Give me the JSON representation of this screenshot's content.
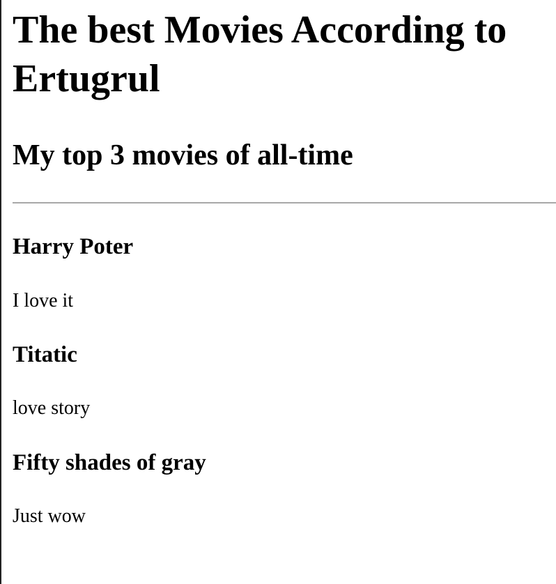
{
  "page": {
    "title": "The best Movies According to Ertugrul",
    "subtitle": "My top 3 movies of all-time"
  },
  "movies": [
    {
      "title": "Harry Poter",
      "description": "I love it"
    },
    {
      "title": "Titatic",
      "description": "love story"
    },
    {
      "title": "Fifty shades of gray",
      "description": "Just wow"
    }
  ]
}
